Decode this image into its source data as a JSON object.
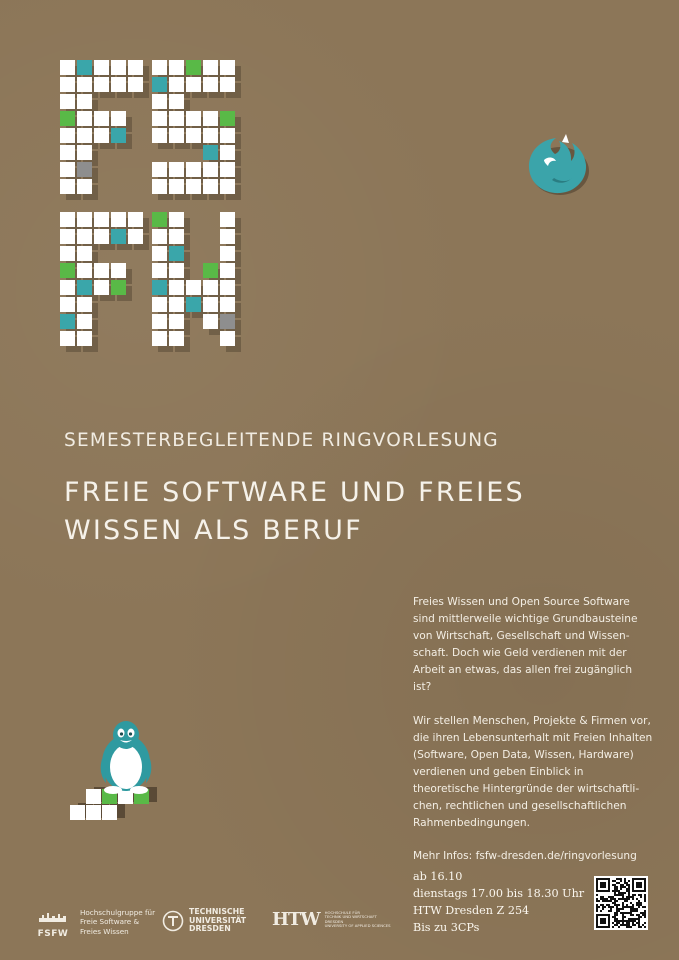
{
  "header": {
    "subtitle": "SEMESTERBEGLEITENDE RINGVORLESUNG",
    "title_line1": "FREIE SOFTWARE UND FREIES",
    "title_line2": "WISSEN ALS BERUF"
  },
  "logo": {
    "letters": [
      "F",
      "S",
      "F",
      "W"
    ],
    "colors": {
      "tile": "#ffffff",
      "teal": "#3aa6aa",
      "green": "#59b947",
      "shadow": "#5a4a36",
      "gray": "#8e8e8e"
    }
  },
  "body": {
    "paragraph1": "Freies Wissen und Open Source Software sind mittlerweile wichtige Grundbausteine von Wirtschaft, Gesellschaft und Wissen-schaft. Doch wie Geld verdienen mit der Arbeit an etwas, das allen frei zugänglich ist?",
    "paragraph2": "Wir stellen Menschen, Projekte & Firmen vor, die ihren Lebensunterhalt mit Freien Inhalten (Software, Open Data, Wissen, Hardware) verdienen und geben Einblick in theoretische Hintergründe der wirtschaftli-chen, rechtlichen und gesellschaftlichen Rahmenbedingungen.",
    "more_info": "Mehr Infos: fsfw-dresden.de/ringvorlesung"
  },
  "event": {
    "start": "ab 16.10",
    "time": "dienstags  17.00 bis 18.30 Uhr",
    "location": "HTW Dresden Z 254",
    "credits": "Bis zu 3CPs"
  },
  "footer": {
    "fsfw_label": "FSFW",
    "fsfw_text_1": "Hochschulgruppe für",
    "fsfw_text_2": "Freie Software &",
    "fsfw_text_3": "Freies  Wissen",
    "tud_line1": "TECHNISCHE",
    "tud_line2": "UNIVERSITÄT",
    "tud_line3": "DRESDEN",
    "htw_mark": "HTW",
    "htw_line1": "HOCHSCHULE FÜR",
    "htw_line2": "TECHNIK UND WIRTSCHAFT",
    "htw_line3": "DRESDEN",
    "htw_line4": "UNIVERSITY OF APPLIED SCIENCES"
  },
  "icons": {
    "firefox": "firefox-icon",
    "tux": "tux-penguin-icon",
    "qr": "qr-code"
  }
}
